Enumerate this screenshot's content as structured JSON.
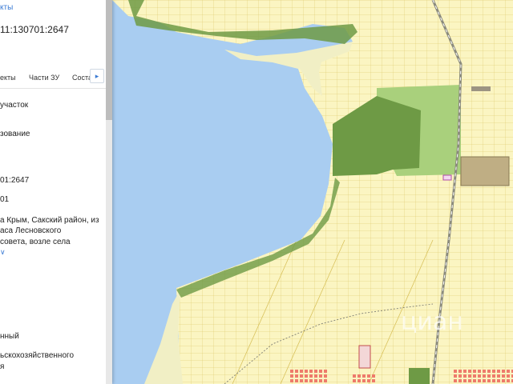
{
  "panel": {
    "link_top": "кты",
    "cadastral_number": "11:130701:2647",
    "tabs": [
      "екты",
      "Части ЗУ",
      "Соста"
    ],
    "tab_next_icon": "chevron-right-icon",
    "lines": [
      "участок",
      "зование",
      "01:2647",
      "01",
      "а Крым, Сакский район, из",
      "аса Лесновского",
      "совета, возле села",
      "нный",
      "ьскохозяйственного",
      "я"
    ],
    "expand_icon": "chevron-down-icon"
  },
  "map": {
    "colors": {
      "water": "#a9cdf1",
      "parcel": "#fbf5c2",
      "parcel_line": "#d9c35e",
      "forest_dark": "#6e9a45",
      "forest_light": "#a9d07c",
      "shore": "#f1efc5",
      "road": "#8a8a7c",
      "built": "#ee7b6b"
    },
    "watermark": "циан"
  }
}
